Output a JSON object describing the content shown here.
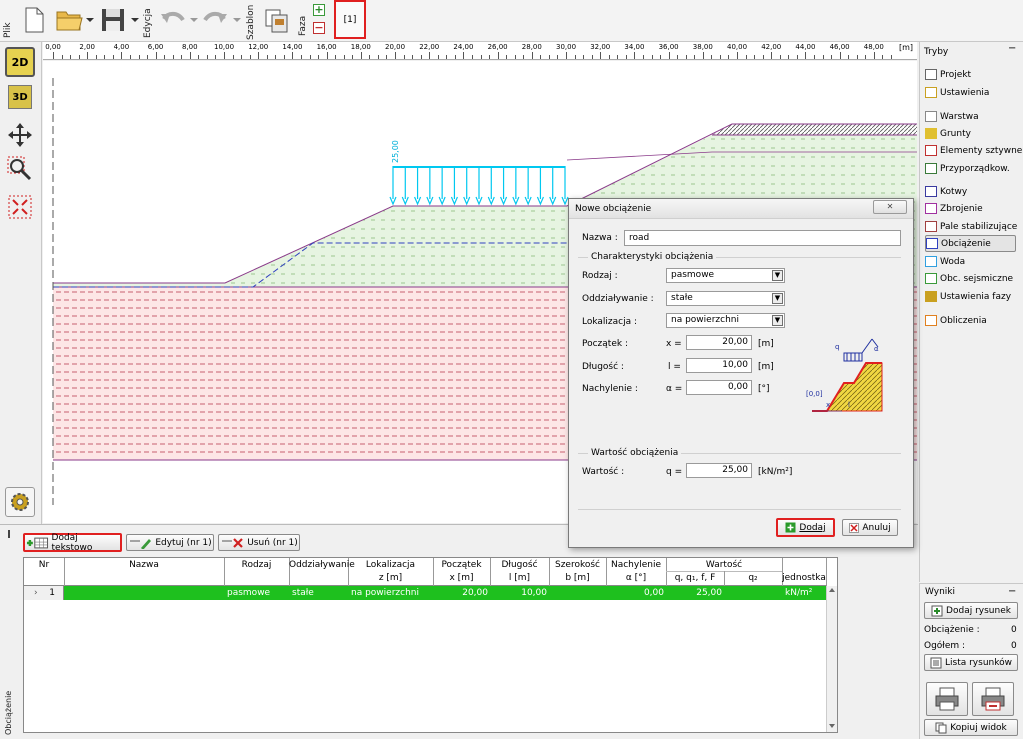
{
  "toolbar": {
    "plik_label": "Plik",
    "edycja_label": "Edycja",
    "szablon_label": "Szablon",
    "faza_label": "Faza",
    "stage_tab": "[1]"
  },
  "ruler": {
    "ticks": [
      "0,00",
      "2,00",
      "4,00",
      "6,00",
      "8,00",
      "10,00",
      "12,00",
      "14,00",
      "16,00",
      "18,00",
      "20,00",
      "22,00",
      "24,00",
      "26,00",
      "28,00",
      "30,00",
      "32,00",
      "34,00",
      "36,00",
      "38,00",
      "40,00",
      "42,00",
      "44,00",
      "46,00",
      "48,00"
    ],
    "unit": "[m]"
  },
  "left_tools": {
    "btn_2d": "2D",
    "btn_3d": "3D"
  },
  "canvas": {
    "load_value": "25,00"
  },
  "modes": {
    "title": "Tryby",
    "items": [
      {
        "label": "Projekt",
        "icon": "document-icon"
      },
      {
        "label": "Ustawienia",
        "icon": "gear-icon"
      },
      {
        "label": "Warstwa",
        "icon": "layer-icon"
      },
      {
        "label": "Grunty",
        "icon": "soil-icon"
      },
      {
        "label": "Elementy sztywne",
        "icon": "rigid-element-icon"
      },
      {
        "label": "Przyporządkow.",
        "icon": "assign-icon"
      },
      {
        "label": "Kotwy",
        "icon": "anchor-icon"
      },
      {
        "label": "Zbrojenie",
        "icon": "reinforcement-icon"
      },
      {
        "label": "Pale stabilizujące",
        "icon": "pile-icon"
      },
      {
        "label": "Obciążenie",
        "icon": "load-icon"
      },
      {
        "label": "Woda",
        "icon": "water-icon"
      },
      {
        "label": "Obc. sejsmiczne",
        "icon": "seismic-icon"
      },
      {
        "label": "Ustawienia fazy",
        "icon": "stage-settings-icon"
      },
      {
        "label": "Obliczenia",
        "icon": "calculation-icon"
      }
    ]
  },
  "results": {
    "title": "Wyniki",
    "add_picture": "Dodaj rysunek",
    "obciazenie_label": "Obciążenie :",
    "obciazenie_value": "0",
    "ogolem_label": "Ogółem :",
    "ogolem_value": "0",
    "list_pictures": "Lista rysunków",
    "copy_view": "Kopiuj widok"
  },
  "dialog": {
    "title": "Nowe obciążenie",
    "close": "✕",
    "name_label": "Nazwa :",
    "name_value": "road",
    "group_char": "Charakterystyki obciążenia",
    "rodzaj_label": "Rodzaj :",
    "rodzaj_value": "pasmowe",
    "oddz_label": "Oddziaływanie :",
    "oddz_value": "stałe",
    "lok_label": "Lokalizacja :",
    "lok_value": "na powierzchni",
    "pocz_label": "Początek :",
    "pocz_sym": "x =",
    "pocz_value": "20,00",
    "pocz_unit": "[m]",
    "dlug_label": "Długość :",
    "dlug_sym": "l =",
    "dlug_value": "10,00",
    "dlug_unit": "[m]",
    "nach_label": "Nachylenie :",
    "nach_sym": "α =",
    "nach_value": "0,00",
    "nach_unit": "[°]",
    "group_val": "Wartość obciążenia",
    "wart_label": "Wartość :",
    "wart_sym": "q =",
    "wart_value": "25,00",
    "wart_unit": "[kN/m²]",
    "diagram_q": "q",
    "diagram_alpha": "α",
    "diagram_origin": "[0,0]",
    "diagram_x": "x",
    "diagram_l": "l",
    "add_btn": "Dodaj",
    "cancel_btn": "Anuluj"
  },
  "bottom": {
    "add_text": "Dodaj tekstowo",
    "edit": "Edytuj (nr 1)",
    "delete": "Usuń (nr 1)",
    "side_label": "Obciążenie",
    "headers": {
      "nr": "Nr",
      "nazwa": "Nazwa",
      "rodzaj": "Rodzaj",
      "oddz": "Oddziaływanie",
      "lok": "Lokalizacja",
      "lok2": "z [m]",
      "pocz": "Początek",
      "pocz2": "x [m]",
      "dlug": "Długość",
      "dlug2": "l [m]",
      "szer": "Szerokość",
      "szer2": "b [m]",
      "nach": "Nachylenie",
      "nach2": "α [°]",
      "wart": "Wartość",
      "wart2a": "q, q₁, f, F",
      "wart2b": "q₂",
      "jedn": "jednostka"
    },
    "row": {
      "nr": "1",
      "nazwa": "",
      "rodzaj": "pasmowe",
      "oddz": "stałe",
      "lok": "na powierzchni",
      "pocz": "20,00",
      "dlug": "10,00",
      "szer": "",
      "nach": "0,00",
      "wart1": "25,00",
      "wart2": "",
      "jedn": "kN/m²"
    }
  }
}
